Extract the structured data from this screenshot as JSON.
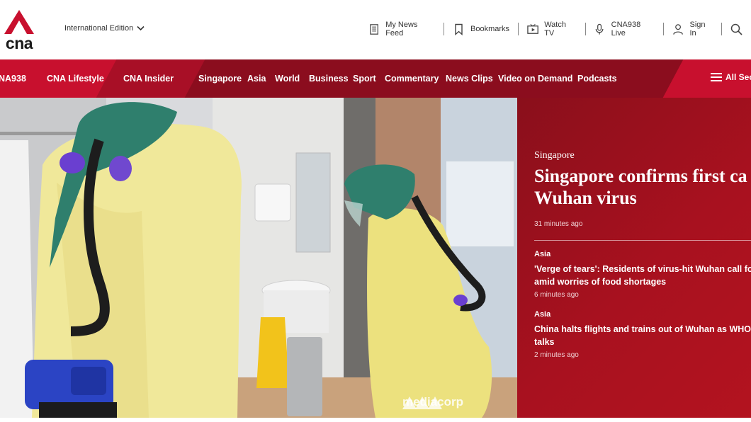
{
  "header": {
    "logo_text": "cna",
    "edition_label": "International Edition",
    "top_links": [
      {
        "label": "My News Feed",
        "icon": "news-feed-icon"
      },
      {
        "label": "Bookmarks",
        "icon": "bookmark-icon"
      },
      {
        "label": "Watch TV",
        "icon": "tv-play-icon"
      },
      {
        "label": "CNA938 Live",
        "icon": "microphone-icon"
      },
      {
        "label": "Sign In",
        "icon": "user-icon"
      }
    ]
  },
  "nav": {
    "links": [
      "NA938",
      "CNA Lifestyle",
      "CNA Insider",
      "Singapore",
      "Asia",
      "World",
      "Business",
      "Sport",
      "Commentary",
      "News Clips",
      "Video on Demand",
      "Podcasts"
    ],
    "all_sections_label": "All Sect"
  },
  "hero": {
    "watermark_text": "mediacorp"
  },
  "lead_story": {
    "category": "Singapore",
    "title_line1": "Singapore confirms first ca",
    "title_line2": "Wuhan virus",
    "time": "31 minutes ago"
  },
  "stories": [
    {
      "category": "Asia",
      "title_line1": "'Verge of tears': Residents of virus-hit Wuhan call for",
      "title_line2": "amid worries of food shortages",
      "time": "6 minutes ago"
    },
    {
      "category": "Asia",
      "title_line1": "China halts flights and trains out of Wuhan as WHO e",
      "title_line2": "talks",
      "time": "2 minutes ago"
    }
  ],
  "colors": {
    "brand_red": "#c8102e",
    "dark_red": "#8b0d1e",
    "panel_red": "#a8111f"
  }
}
